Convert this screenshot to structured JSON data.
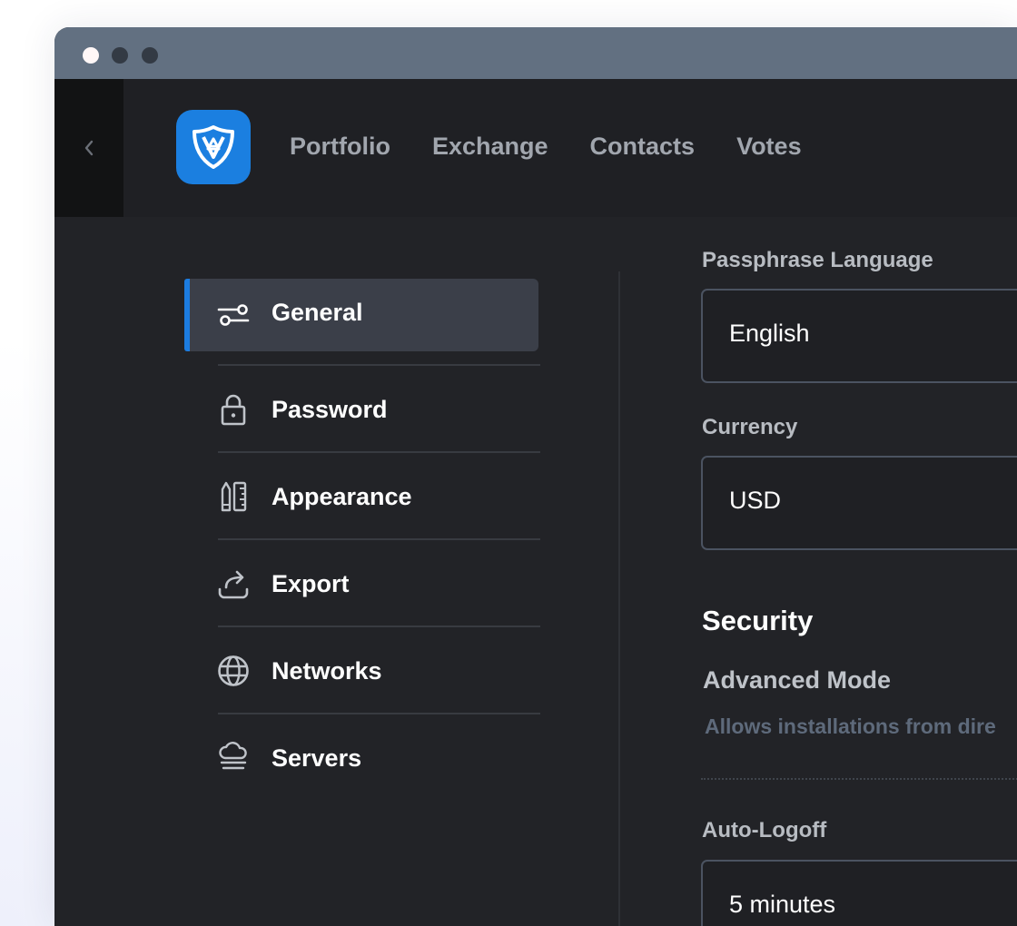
{
  "window": {
    "controls": [
      "close",
      "minimize",
      "maximize"
    ],
    "back_icon": "chevron-left-icon"
  },
  "header": {
    "logo_icon": "shield-logo-icon",
    "nav": [
      {
        "label": "Portfolio"
      },
      {
        "label": "Exchange"
      },
      {
        "label": "Contacts"
      },
      {
        "label": "Votes"
      }
    ]
  },
  "sidebar": {
    "items": [
      {
        "label": "General",
        "icon": "sliders-icon",
        "active": true
      },
      {
        "label": "Password",
        "icon": "lock-icon"
      },
      {
        "label": "Appearance",
        "icon": "pencil-ruler-icon"
      },
      {
        "label": "Export",
        "icon": "share-icon"
      },
      {
        "label": "Networks",
        "icon": "globe-icon"
      },
      {
        "label": "Servers",
        "icon": "server-cloud-icon"
      }
    ]
  },
  "settings": {
    "passphrase_language": {
      "label": "Passphrase Language",
      "value": "English"
    },
    "currency": {
      "label": "Currency",
      "value": "USD"
    },
    "security": {
      "title": "Security",
      "advanced_mode": {
        "title": "Advanced Mode",
        "description": "Allows installations from dire"
      }
    },
    "auto_logoff": {
      "label": "Auto-Logoff",
      "value": "5 minutes"
    }
  },
  "colors": {
    "accent": "#1c7ce0",
    "titlebar": "#627081",
    "background": "#222327",
    "active_item": "#3b3f49"
  }
}
